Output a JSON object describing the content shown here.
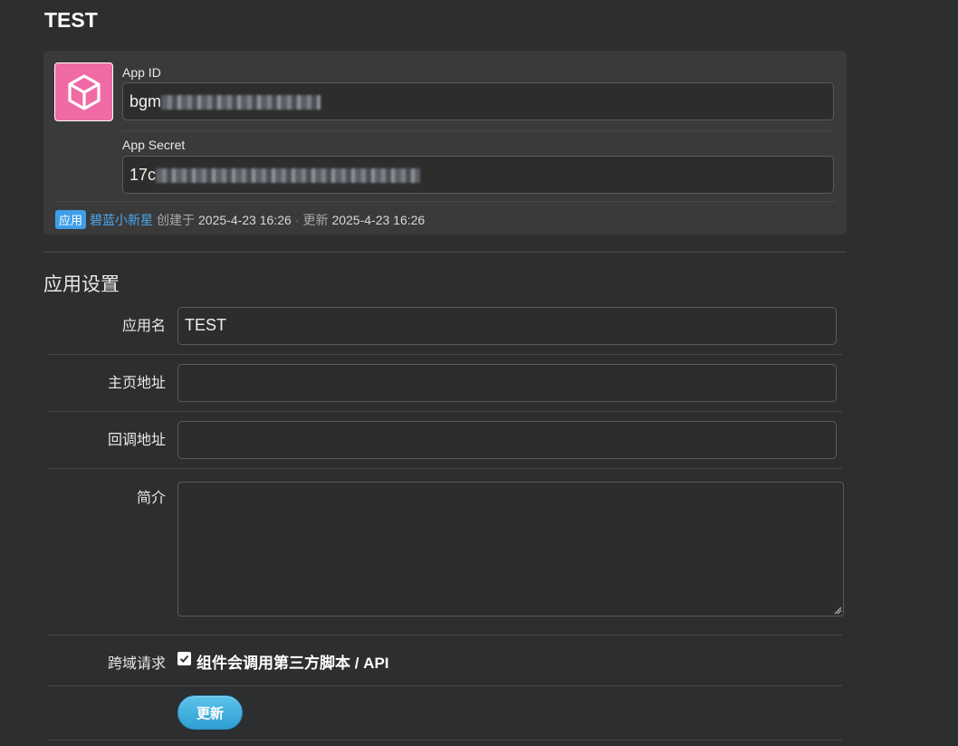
{
  "page": {
    "title": "TEST"
  },
  "credentials": {
    "app_id_label": "App ID",
    "app_id_value": "bgm",
    "app_secret_label": "App Secret",
    "app_secret_value": "17c",
    "icon": "cube-icon",
    "icon_bg_color": "#f06aa5"
  },
  "meta": {
    "badge": "应用",
    "author": "碧蓝小新星",
    "created_label": "创建于",
    "created_at": "2025-4-23 16:26",
    "separator": "·",
    "updated_label": "更新",
    "updated_at": "2025-4-23 16:26"
  },
  "settings": {
    "title": "应用设置",
    "name_label": "应用名",
    "name_value": "TEST",
    "homepage_label": "主页地址",
    "homepage_value": "",
    "callback_label": "回调地址",
    "callback_value": "",
    "intro_label": "简介",
    "intro_value": "",
    "cors_label": "跨域请求",
    "cors_checkbox_label": "组件会调用第三方脚本 / API",
    "cors_checked": true,
    "submit_label": "更新"
  },
  "colors": {
    "background": "#2d2e30",
    "accent": "#3f9ee8",
    "button": "#2f9fd3"
  }
}
